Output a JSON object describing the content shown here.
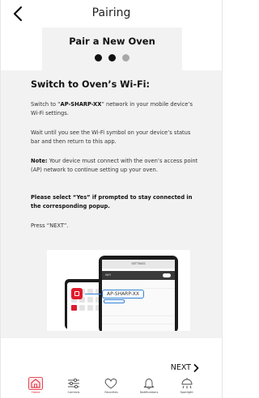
{
  "header": {
    "title": "Pairing"
  },
  "steps": {
    "title": "Pair a New Oven",
    "current_step": 2,
    "total_steps": 3
  },
  "content": {
    "title": "Switch to Oven’s Wi-Fi:",
    "p1_pre": "Switch to “",
    "p1_bold": "AP-SHARP-XX",
    "p1_post": "” network in your mobile device’s Wi-Fi settings.",
    "p2": "Wait until you see the Wi-Fi symbol on your device’s status bar and then return to this app.",
    "p3_bold": "Note:",
    "p3_rest": " Your device must connect with the oven’s access point (AP) network to continue setting up your oven.",
    "p4": "Please select “Yes” if prompted to stay connected in the corresponding popup.",
    "p5": "Press “NEXT”.",
    "illustration": {
      "settings_label": "SETTINGS",
      "wifi_label": "WiFi",
      "network_label": "AP-SHARP-XX"
    }
  },
  "next": {
    "label": "NEXT"
  },
  "tabbar": {
    "tabs": [
      {
        "label": "Home",
        "icon": "home-icon",
        "active": true
      },
      {
        "label": "Controls",
        "icon": "sliders-icon",
        "active": false
      },
      {
        "label": "Favorites",
        "icon": "heart-icon",
        "active": false
      },
      {
        "label": "Notifications",
        "icon": "bell-icon",
        "active": false
      },
      {
        "label": "Spotlight",
        "icon": "spotlight-icon",
        "active": false
      }
    ]
  },
  "colors": {
    "accent": "#e01a2e",
    "panel": "#f2f2f2",
    "link_blue": "#2f7fd6"
  }
}
